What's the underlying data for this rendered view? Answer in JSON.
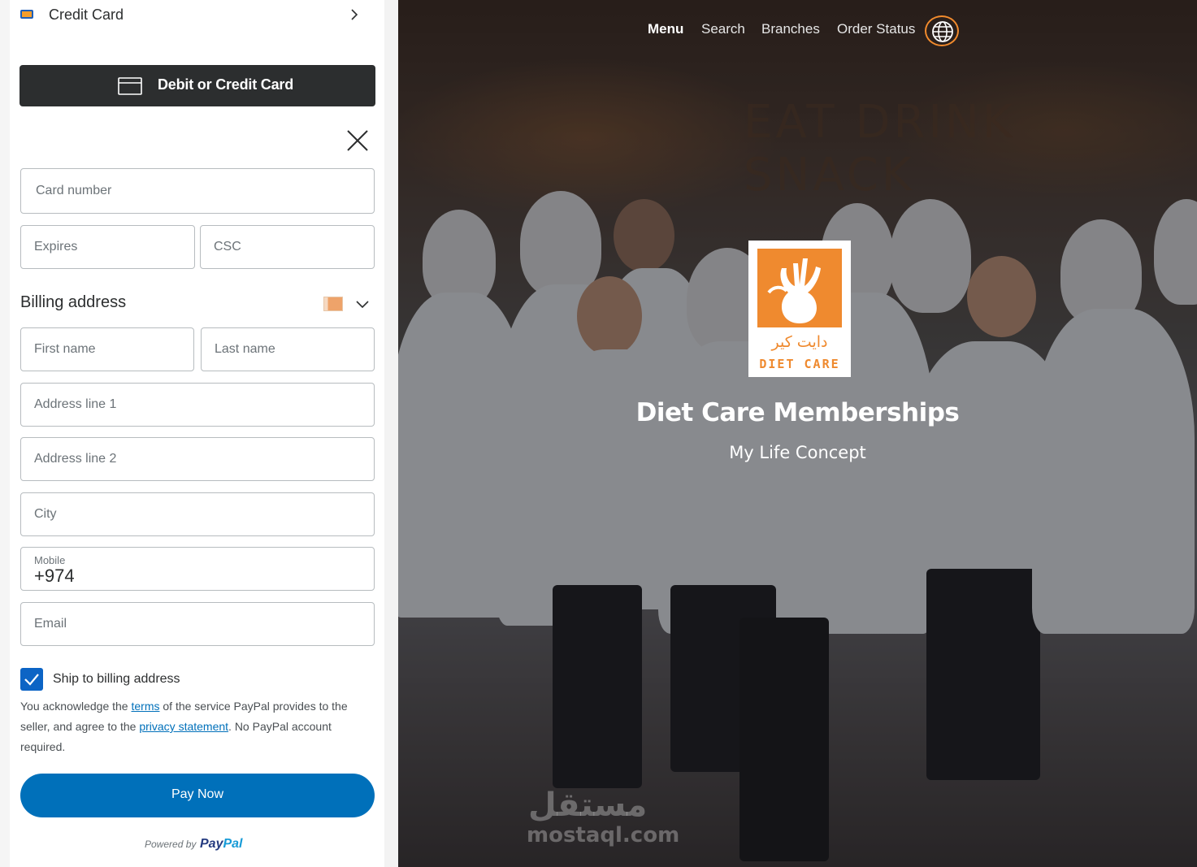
{
  "checkout": {
    "method_label": "Credit Card",
    "debit_button_label": "Debit or Credit Card",
    "card_number_placeholder": "Card number",
    "expires_placeholder": "Expires",
    "csc_placeholder": "CSC",
    "billing_title": "Billing address",
    "first_name_placeholder": "First name",
    "last_name_placeholder": "Last name",
    "address1_placeholder": "Address line 1",
    "address2_placeholder": "Address line 2",
    "city_placeholder": "City",
    "mobile_caption": "Mobile",
    "mobile_value": "+974",
    "email_placeholder": "Email",
    "ship_label": "Ship to billing address",
    "ship_checked": true,
    "legal": {
      "part1": "You acknowledge the ",
      "terms_link": "terms",
      "part2": " of the service PayPal provides to the seller, and agree to the ",
      "privacy_link": "privacy statement",
      "part3": ". No PayPal account required."
    },
    "pay_button_label": "Pay Now",
    "powered_by": "Powered by",
    "brand_part1": "Pay",
    "brand_part2": "Pal",
    "colors": {
      "button_dark": "#2c2e2f",
      "pay_blue": "#0070ba",
      "checkbox_blue": "#0c64c5"
    }
  },
  "hero": {
    "nav": [
      "Menu",
      "Search",
      "Branches",
      "Order Status"
    ],
    "active_nav": "Menu",
    "language_icon": "globe-icon",
    "wall_text": "EAT DRINK SNACK",
    "logo_arabic": "دايت كير",
    "logo_english": "DIET CARE",
    "title": "Diet Care Memberships",
    "subtitle": "My Life Concept",
    "watermark_arabic": "مستقل",
    "watermark_latin": "mostaql.com",
    "colors": {
      "accent_orange": "#ef8a2f",
      "globe_ring": "#f28b2d"
    }
  }
}
